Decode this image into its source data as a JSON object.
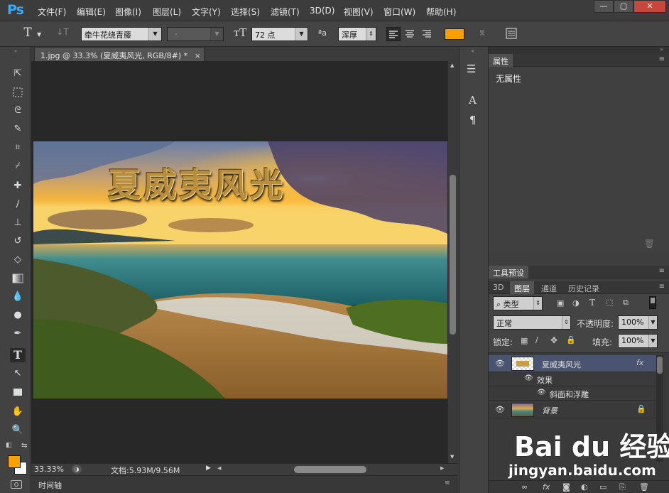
{
  "app": {
    "logo": "Ps",
    "menu": [
      "文件(F)",
      "编辑(E)",
      "图像(I)",
      "图层(L)",
      "文字(Y)",
      "选择(S)",
      "滤镜(T)",
      "3D(D)",
      "视图(V)",
      "窗口(W)",
      "帮助(H)"
    ],
    "window_buttons": {
      "minimize": "—",
      "maximize": "▢",
      "close": "✕"
    }
  },
  "options_bar": {
    "tool_glyph": "T",
    "orient_glyph": "↓T",
    "font_family": "牵牛花绕青藤",
    "font_style": "-",
    "size_glyph": "тT",
    "font_size": "72 点",
    "aa_glyph": "ªa",
    "antialias": "浑厚",
    "text_color": "#f7a000"
  },
  "document": {
    "tab_title": "1.jpg @ 33.3% (夏威夷风光, RGB/8#) *",
    "tab_close": "×",
    "title_art_text": "夏威夷风光"
  },
  "status": {
    "zoom": "33.33%",
    "doc_info": "文档:5.93M/9.56M",
    "timeline": "时间轴"
  },
  "colors": {
    "foreground": "#f7a000",
    "background": "#ffffff"
  },
  "properties_panel": {
    "tab": "属性",
    "content": "无属性"
  },
  "tool_presets_panel": {
    "tab": "工具预设"
  },
  "layers_panel": {
    "tabs": [
      "3D",
      "图层",
      "通道",
      "历史记录"
    ],
    "filter_kind": "类型",
    "blend_mode": "正常",
    "opacity_label": "不透明度:",
    "opacity": "100%",
    "lock_label": "锁定:",
    "fill_label": "填充:",
    "fill": "100%",
    "layers": [
      {
        "name": "夏威夷风光",
        "fx": "fx",
        "effects_label": "效果",
        "effect": "斜面和浮雕"
      },
      {
        "name": "背景",
        "locked": true
      }
    ]
  },
  "watermark": {
    "brand": "Bai du 经验",
    "url": "jingyan.baidu.com"
  }
}
